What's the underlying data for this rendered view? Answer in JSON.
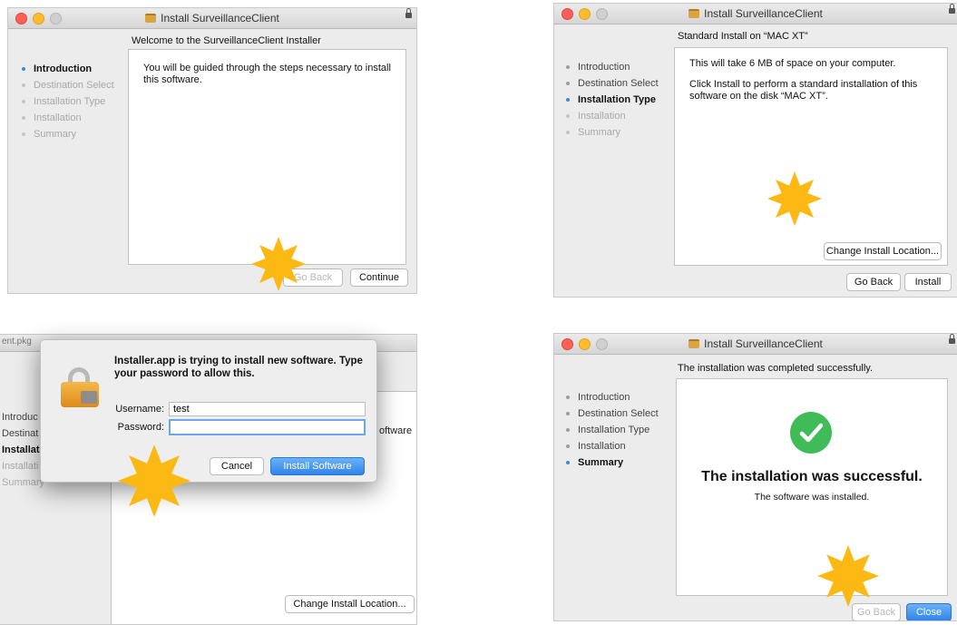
{
  "app_title": "Install SurveillanceClient",
  "steps": [
    "Introduction",
    "Destination Select",
    "Installation Type",
    "Installation",
    "Summary"
  ],
  "screen1": {
    "heading": "Welcome to the SurveillanceClient Installer",
    "body": "You will be guided through the steps necessary to install this software.",
    "back_label": "Go Back",
    "continue_label": "Continue"
  },
  "screen2": {
    "heading": "Standard Install on “MAC XT”",
    "space_text": "This will take 6 MB of space on your computer.",
    "install_text": "Click Install to perform a standard installation of this software on the disk “MAC XT”.",
    "change_location_label": "Change Install Location...",
    "back_label": "Go Back",
    "install_label": "Install"
  },
  "screen3": {
    "bg_title_fragment": "ent.pkg",
    "bg_steps": [
      "Introduc",
      "Destinat",
      "Installat",
      "Installati",
      "Summary"
    ],
    "bg_text_fragment": "oftware",
    "change_location_label": "Change Install Location...",
    "dialog": {
      "message": "Installer.app is trying to install new software. Type your password to allow this.",
      "username_label": "Username:",
      "username_value": "test",
      "password_label": "Password:",
      "password_value": "",
      "cancel_label": "Cancel",
      "install_label": "Install Software"
    }
  },
  "screen4": {
    "heading": "The installation was completed successfully.",
    "success_title": "The installation was successful.",
    "success_sub": "The software was installed.",
    "back_label": "Go Back",
    "close_label": "Close"
  },
  "colors": {
    "accent": "#3b87e0",
    "highlight_star": "#fdb913",
    "success_green": "#3fbb58"
  },
  "icons": [
    "package-icon",
    "lock-icon",
    "checkmark-icon",
    "padlock-icon",
    "highlight-star-icon"
  ]
}
